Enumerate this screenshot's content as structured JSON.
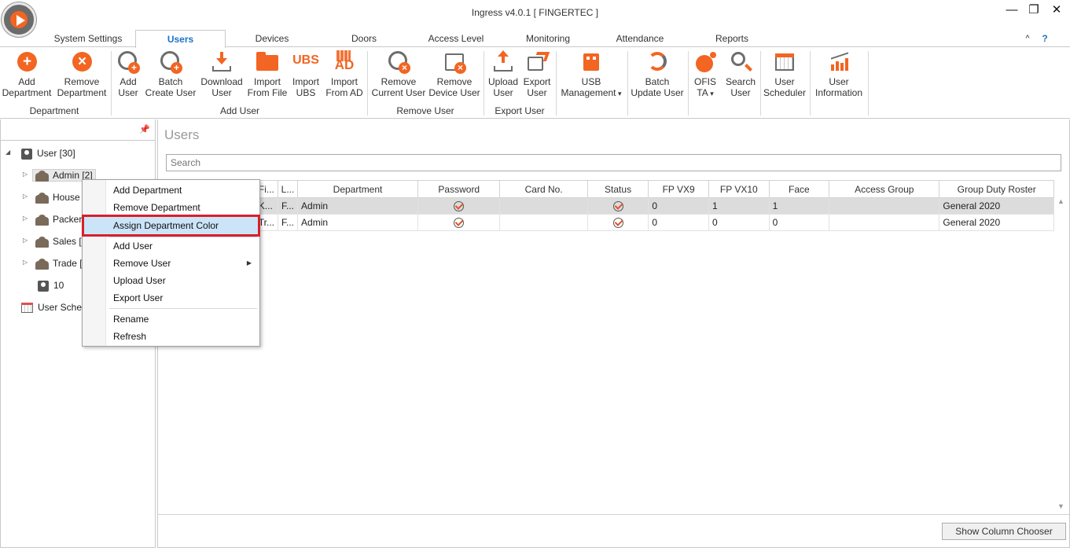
{
  "window": {
    "title": "Ingress v4.0.1 [ FINGERTEC ]",
    "minimize": "—",
    "restore": "❐",
    "close": "✕",
    "collapse_ribbon": "^",
    "help": "?"
  },
  "tabs": [
    {
      "label": "System Settings"
    },
    {
      "label": "Users",
      "active": true
    },
    {
      "label": "Devices"
    },
    {
      "label": "Doors"
    },
    {
      "label": "Access Level"
    },
    {
      "label": "Monitoring"
    },
    {
      "label": "Attendance"
    },
    {
      "label": "Reports"
    }
  ],
  "ribbon": {
    "add_department": {
      "l1": "Add",
      "l2": "Department"
    },
    "remove_department": {
      "l1": "Remove",
      "l2": "Department"
    },
    "group_department": "Department",
    "add_user": {
      "l1": "Add",
      "l2": "User"
    },
    "batch_create_user": {
      "l1": "Batch",
      "l2": "Create User"
    },
    "download_user": {
      "l1": "Download",
      "l2": "User"
    },
    "import_from_file": {
      "l1": "Import",
      "l2": "From File"
    },
    "import_ubs": {
      "l1": "Import",
      "l2": "UBS",
      "icon_text": "UBS"
    },
    "import_from_ad": {
      "l1": "Import",
      "l2": "From AD",
      "icon_text": "AD"
    },
    "group_add_user": "Add User",
    "remove_current_user": {
      "l1": "Remove",
      "l2": "Current User"
    },
    "remove_device_user": {
      "l1": "Remove",
      "l2": "Device User"
    },
    "group_remove_user": "Remove User",
    "upload_user": {
      "l1": "Upload",
      "l2": "User"
    },
    "export_user": {
      "l1": "Export",
      "l2": "User"
    },
    "group_export_user": "Export User",
    "usb_management": {
      "l1": "USB",
      "l2": "Management"
    },
    "batch_update_user": {
      "l1": "Batch",
      "l2": "Update User"
    },
    "ofis_ta": {
      "l1": "OFIS",
      "l2": "TA"
    },
    "search_user": {
      "l1": "Search",
      "l2": "User"
    },
    "user_scheduler": {
      "l1": "User",
      "l2": "Scheduler"
    },
    "user_information": {
      "l1": "User",
      "l2": "Information"
    }
  },
  "tree": {
    "pin": "📌",
    "root": "User [30]",
    "children": [
      "Admin [2]",
      "House",
      "Packer",
      "Sales [1",
      "Trade ["
    ],
    "leaf": "10",
    "scheduler": "User Sched"
  },
  "main": {
    "title": "Users",
    "search_placeholder": "Search",
    "columns": [
      "",
      "Fi...",
      "L...",
      "Department",
      "Password",
      "Card No.",
      "Status",
      "FP VX9",
      "FP VX10",
      "Face",
      "Access Group",
      "Group Duty Roster"
    ],
    "rows": [
      {
        "c0": "",
        "c1": "K...",
        "c2": "F...",
        "department": "Admin",
        "card": "",
        "fp9": "0",
        "fp10": "1",
        "face": "1",
        "access": "",
        "roster": "General 2020"
      },
      {
        "c0": "",
        "c1": "Tr...",
        "c2": "F...",
        "department": "Admin",
        "card": "",
        "fp9": "0",
        "fp10": "0",
        "face": "0",
        "access": "",
        "roster": "General 2020"
      }
    ],
    "show_column_chooser": "Show Column Chooser"
  },
  "context_menu": {
    "items": [
      {
        "label": "Add Department"
      },
      {
        "label": "Remove Department"
      },
      {
        "label": "Assign Department Color",
        "highlighted": true
      },
      {
        "label": "Add User"
      },
      {
        "label": "Remove User",
        "submenu": true
      },
      {
        "label": "Upload User"
      },
      {
        "label": "Export User"
      },
      {
        "label": "Rename"
      },
      {
        "label": "Refresh"
      }
    ]
  },
  "colors": {
    "accent": "#f26522",
    "active_tab": "#1e72c7",
    "highlight_border": "#d6202b",
    "menu_highlight": "#cce4f7"
  }
}
